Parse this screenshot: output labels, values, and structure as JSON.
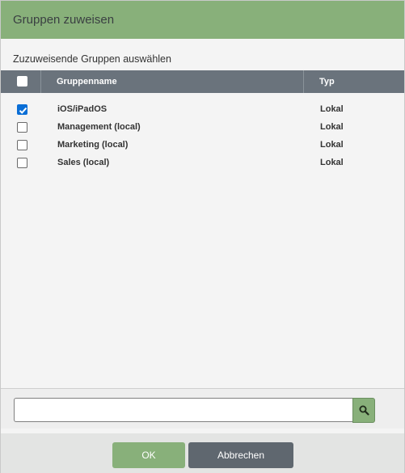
{
  "dialog": {
    "title": "Gruppen zuweisen",
    "subtitle": "Zuzuweisende Gruppen auswählen"
  },
  "table": {
    "columns": [
      "Gruppenname",
      "Typ"
    ],
    "rows": [
      {
        "name": "iOS/iPadOS",
        "type": "Lokal",
        "checked": true
      },
      {
        "name": "Management (local)",
        "type": "Lokal",
        "checked": false
      },
      {
        "name": "Marketing (local)",
        "type": "Lokal",
        "checked": false
      },
      {
        "name": "Sales (local)",
        "type": "Lokal",
        "checked": false
      }
    ]
  },
  "search": {
    "value": "",
    "placeholder": "",
    "icon": "search-icon"
  },
  "footer": {
    "ok_label": "OK",
    "cancel_label": "Abbrechen"
  },
  "colors": {
    "accent": "#88b07a",
    "header": "#6a737c",
    "cancel": "#5f676f",
    "checkbox_checked": "#0a6ed6"
  }
}
